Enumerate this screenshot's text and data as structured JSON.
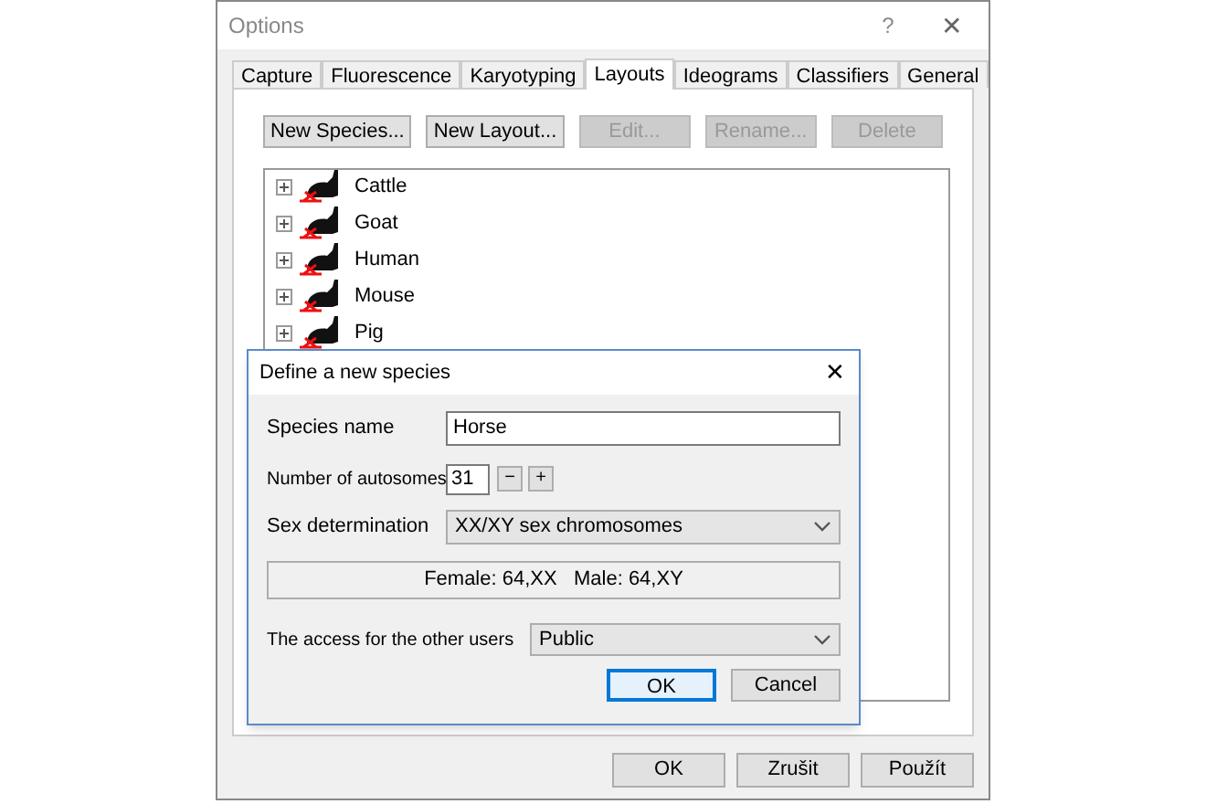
{
  "window": {
    "title": "Options",
    "help": "?",
    "close": "✕"
  },
  "tabs": [
    {
      "label": "Capture",
      "selected": false
    },
    {
      "label": "Fluorescence",
      "selected": false
    },
    {
      "label": "Karyotyping",
      "selected": false
    },
    {
      "label": "Layouts",
      "selected": true
    },
    {
      "label": "Ideograms",
      "selected": false
    },
    {
      "label": "Classifiers",
      "selected": false
    },
    {
      "label": "General",
      "selected": false
    }
  ],
  "toolbar": [
    {
      "label": "New Species...",
      "disabled": false
    },
    {
      "label": "New Layout...",
      "disabled": false
    },
    {
      "label": "Edit...",
      "disabled": true
    },
    {
      "label": "Rename...",
      "disabled": true
    },
    {
      "label": "Delete",
      "disabled": true
    }
  ],
  "tree": [
    {
      "label": "Cattle",
      "expanded": false
    },
    {
      "label": "Goat",
      "expanded": false
    },
    {
      "label": "Human",
      "expanded": false
    },
    {
      "label": "Mouse",
      "expanded": false
    },
    {
      "label": "Pig",
      "expanded": false
    }
  ],
  "dialog": {
    "title": "Define a new species",
    "close": "✕",
    "species_name": {
      "label": "Species name",
      "value": "Horse"
    },
    "autosomes": {
      "label": "Number of autosomes",
      "value": "31",
      "minus": "−",
      "plus": "+"
    },
    "sex_determination": {
      "label": "Sex determination",
      "value": "XX/XY sex chromosomes"
    },
    "karyotype": "Female: 64,XX   Male: 64,XY",
    "access": {
      "label": "The access for the other users",
      "value": "Public"
    },
    "buttons": [
      {
        "label": "OK",
        "default": true
      },
      {
        "label": "Cancel",
        "default": false
      }
    ]
  },
  "buttons": [
    "OK",
    "Zrušit",
    "Použít"
  ]
}
